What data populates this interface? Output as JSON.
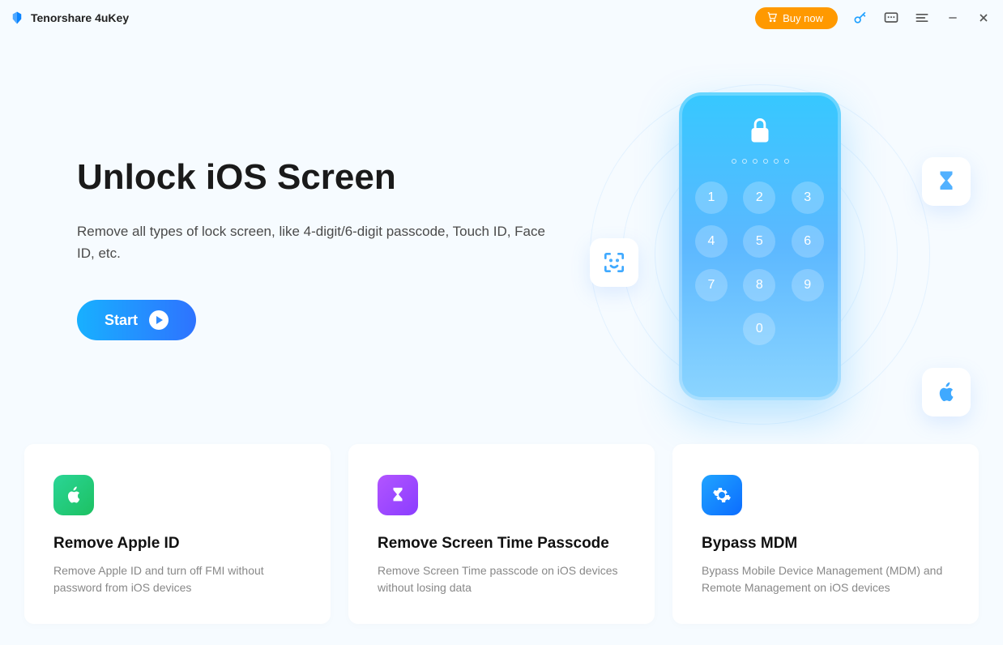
{
  "app": {
    "title": "Tenorshare 4uKey"
  },
  "header": {
    "buy_label": "Buy now"
  },
  "hero": {
    "title": "Unlock iOS Screen",
    "description": "Remove all types of lock screen, like 4-digit/6-digit passcode, Touch ID, Face ID, etc.",
    "start_label": "Start",
    "keypad": [
      "1",
      "2",
      "3",
      "4",
      "5",
      "6",
      "7",
      "8",
      "9",
      "0"
    ]
  },
  "cards": [
    {
      "title": "Remove Apple ID",
      "description": "Remove Apple ID and turn off FMI without password from iOS devices"
    },
    {
      "title": "Remove Screen Time Passcode",
      "description": "Remove Screen Time passcode on iOS devices without losing data"
    },
    {
      "title": "Bypass MDM",
      "description": "Bypass Mobile Device Management (MDM) and Remote Management on iOS devices"
    }
  ]
}
